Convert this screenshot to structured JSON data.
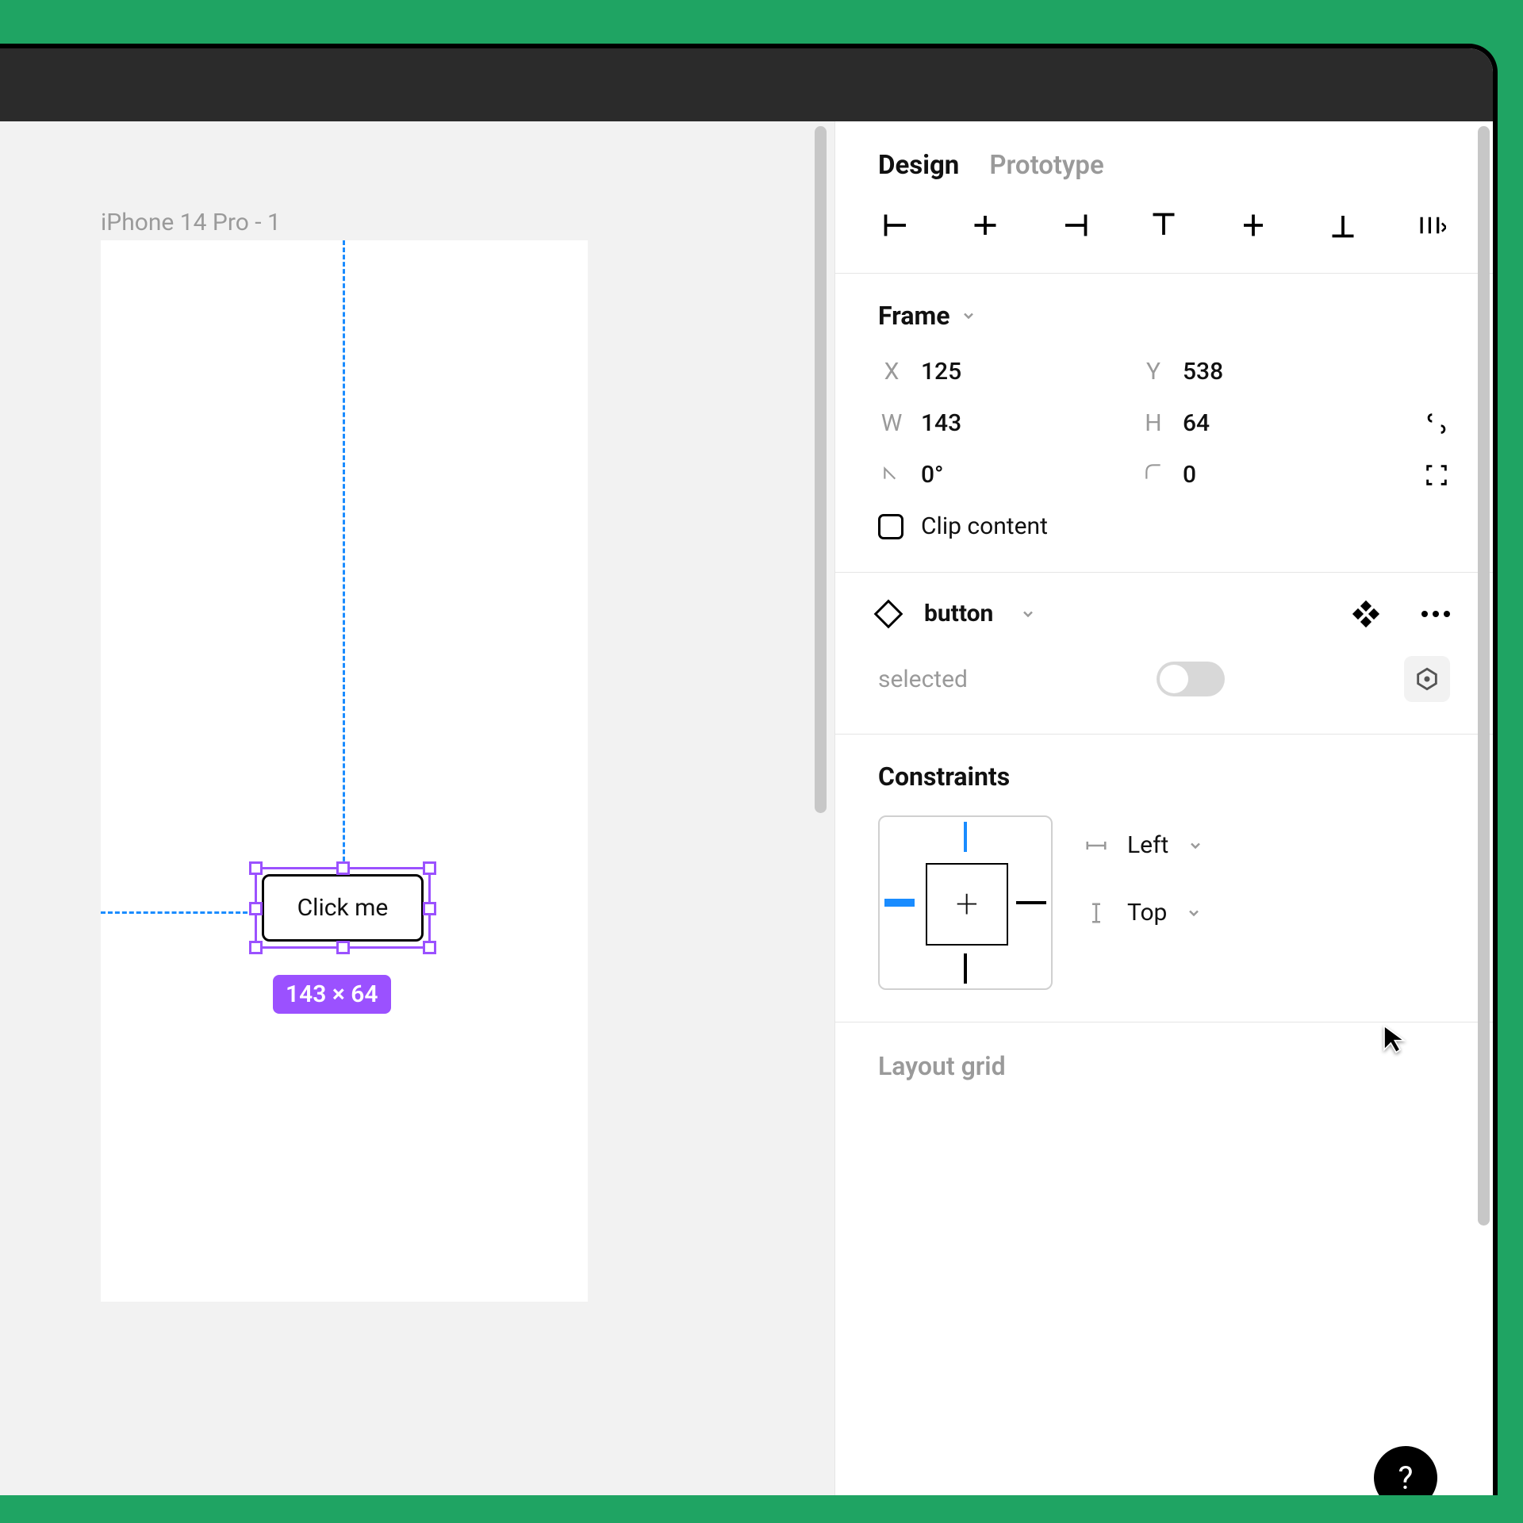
{
  "canvas": {
    "frame_label": "iPhone 14 Pro - 1",
    "button_text": "Click me",
    "dimension_label": "143 × 64"
  },
  "panel": {
    "tabs": {
      "design": "Design",
      "prototype": "Prototype"
    },
    "frame": {
      "title": "Frame",
      "x_label": "X",
      "x_value": "125",
      "y_label": "Y",
      "y_value": "538",
      "w_label": "W",
      "w_value": "143",
      "h_label": "H",
      "h_value": "64",
      "rotation": "0°",
      "corner_radius": "0",
      "clip_label": "Clip content"
    },
    "component": {
      "name": "button",
      "property_label": "selected"
    },
    "constraints": {
      "title": "Constraints",
      "h": "Left",
      "v": "Top"
    },
    "layout_grid": "Layout grid",
    "help": "?"
  }
}
